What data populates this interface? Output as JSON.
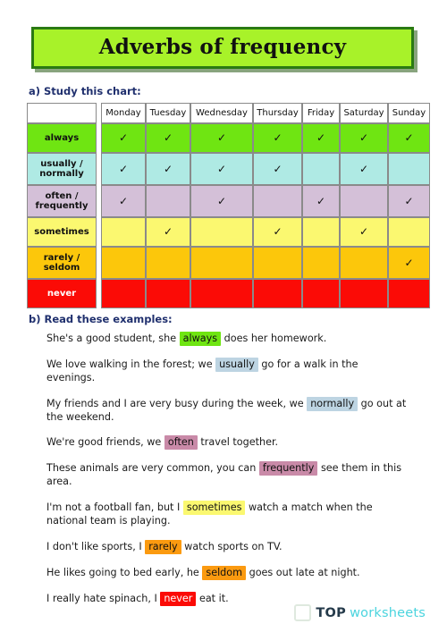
{
  "title": "Adverbs of frequency",
  "sections": {
    "a_heading": "a) Study this chart:",
    "b_heading": "b) Read these examples:"
  },
  "chart_data": {
    "type": "table",
    "title": "Adverbs of frequency",
    "corner_label": "",
    "categories": [
      "Monday",
      "Tuesday",
      "Wednesday",
      "Thursday",
      "Friday",
      "Saturday",
      "Sunday"
    ],
    "check_glyph": "✓",
    "rows": [
      {
        "label": "always",
        "color": "#6fe512",
        "label_text_color": "#111111",
        "values": [
          true,
          true,
          true,
          true,
          true,
          true,
          true
        ]
      },
      {
        "label": "usually / normally",
        "color": "#afeae4",
        "label_text_color": "#111111",
        "values": [
          true,
          true,
          true,
          true,
          false,
          true,
          false
        ]
      },
      {
        "label": "often / frequently",
        "color": "#d4c0d8",
        "label_text_color": "#111111",
        "values": [
          true,
          false,
          true,
          false,
          true,
          false,
          true
        ]
      },
      {
        "label": "sometimes",
        "color": "#fbf870",
        "label_text_color": "#111111",
        "values": [
          false,
          true,
          false,
          true,
          false,
          true,
          false
        ]
      },
      {
        "label": "rarely / seldom",
        "color": "#fcc70b",
        "label_text_color": "#111111",
        "values": [
          false,
          false,
          false,
          false,
          false,
          false,
          true
        ]
      },
      {
        "label": "never",
        "color": "#fb0b06",
        "label_text_color": "#ffffff",
        "values": [
          false,
          false,
          false,
          false,
          false,
          false,
          false
        ]
      }
    ]
  },
  "examples": [
    {
      "before": "She's a good student, she ",
      "highlight": "always",
      "highlight_class": "hl-always",
      "after": " does her homework."
    },
    {
      "before": "We love walking in the forest; we ",
      "highlight": "usually",
      "highlight_class": "hl-usually",
      "after": " go for a walk in the evenings."
    },
    {
      "before": "My friends and I are very busy during the week, we ",
      "highlight": "normally",
      "highlight_class": "hl-normally",
      "after": " go out at the weekend."
    },
    {
      "before": "We're good friends, we ",
      "highlight": "often",
      "highlight_class": "hl-often",
      "after": " travel together."
    },
    {
      "before": "These animals are very common, you can ",
      "highlight": "frequently",
      "highlight_class": "hl-frequently",
      "after": " see them in this area."
    },
    {
      "before": "I'm not a football fan, but I ",
      "highlight": "sometimes",
      "highlight_class": "hl-sometimes",
      "after": " watch a match when the national team is playing."
    },
    {
      "before": "I don't like sports, I ",
      "highlight": "rarely",
      "highlight_class": "hl-rarely",
      "after": " watch sports on TV."
    },
    {
      "before": "He likes going to bed early, he ",
      "highlight": "seldom",
      "highlight_class": "hl-seldom",
      "after": " goes out late at night."
    },
    {
      "before": "I really hate spinach, I ",
      "highlight": "never",
      "highlight_class": "hl-never",
      "after": " eat it."
    }
  ],
  "footer": {
    "logo_top": "TOP",
    "logo_worksheets": "worksheets"
  },
  "colors": {
    "title_banner_bg": "#a8f229",
    "title_banner_border": "#2a7a12",
    "heading_text": "#20306e",
    "logo_top": "#243a4a",
    "logo_worksheets": "#4ad4de"
  }
}
